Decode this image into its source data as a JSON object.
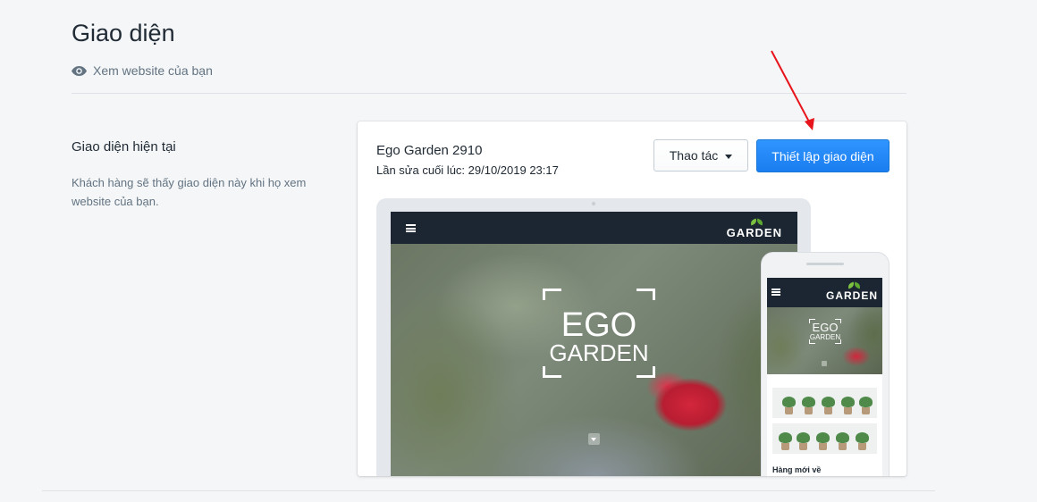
{
  "page": {
    "title": "Giao diện",
    "view_website": "Xem website của bạn"
  },
  "section": {
    "heading": "Giao diện hiện tại",
    "description": "Khách hàng sẽ thấy giao diện này khi họ xem website của bạn."
  },
  "theme": {
    "name": "Ego Garden 2910",
    "last_edited": "Lần sửa cuối lúc: 29/10/2019 23:17",
    "actions_button": "Thao tác",
    "customize_button": "Thiết lập giao diện"
  },
  "preview": {
    "logo_text": "GARDEN",
    "hero_line1": "EGO",
    "hero_line2": "GARDEN",
    "mobile_products_title": "Hàng mới về"
  },
  "colors": {
    "primary": "#1a7df0",
    "annotation_arrow": "#e8141b",
    "nav_dark": "#1b2632",
    "logo_leaf": "#7cc142"
  },
  "icons": {
    "view_website": "eye-icon",
    "actions_dropdown": "caret-down-icon",
    "preview_menu": "hamburger-menu-icon",
    "preview_scroll": "arrow-down-icon"
  }
}
